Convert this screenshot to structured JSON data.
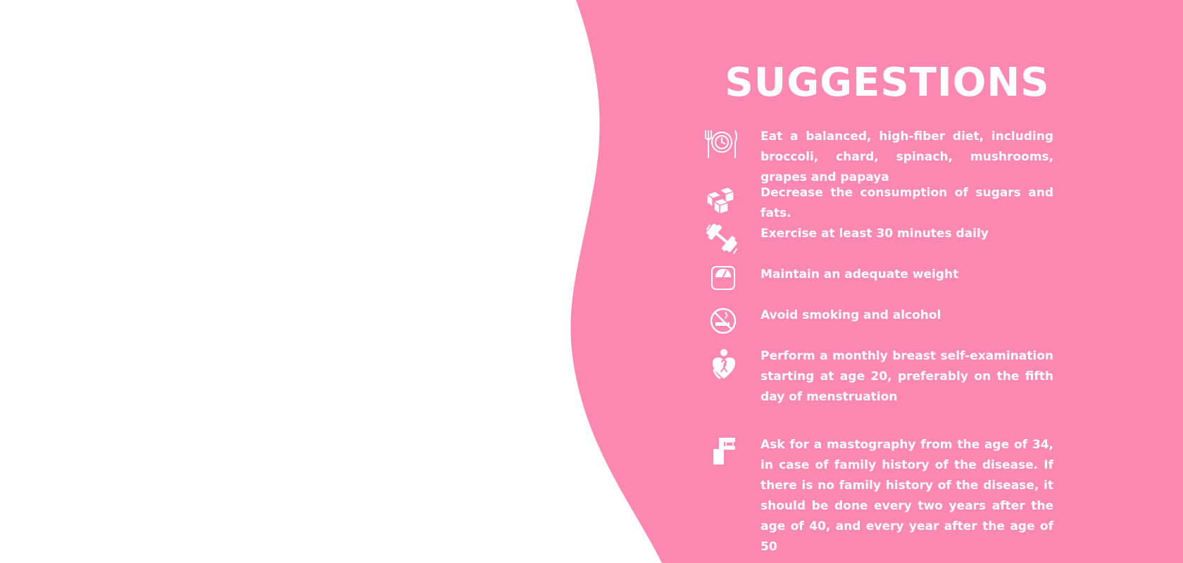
{
  "title": "SUGGESTIONS",
  "colors": {
    "background": "#ffffff",
    "accent_pink": "#ff88b0",
    "text": "#ffffff"
  },
  "suggestions": [
    {
      "icon": "plate-cutlery-icon",
      "text": "Eat a balanced, high-fiber diet, including broccoli, chard, spinach, mushrooms, grapes and papaya"
    },
    {
      "icon": "sugar-cubes-icon",
      "text": "Decrease the consumption of sugars and fats."
    },
    {
      "icon": "dumbbell-icon",
      "text": "Exercise at least 30 minutes daily"
    },
    {
      "icon": "weight-scale-icon",
      "text": "Maintain an adequate weight"
    },
    {
      "icon": "no-smoking-icon",
      "text": "Avoid smoking and alcohol"
    },
    {
      "icon": "self-exam-ribbon-icon",
      "text": "Perform a monthly breast self-examination starting at age 20, preferably on the fifth day of menstruation"
    },
    {
      "icon": "mammography-machine-icon",
      "text": "Ask for a mastography from the age of 34, in case of family history of the disease. If there is no family history of the disease, it should be done every two years after the age of 40, and every year after the age of 50"
    }
  ]
}
